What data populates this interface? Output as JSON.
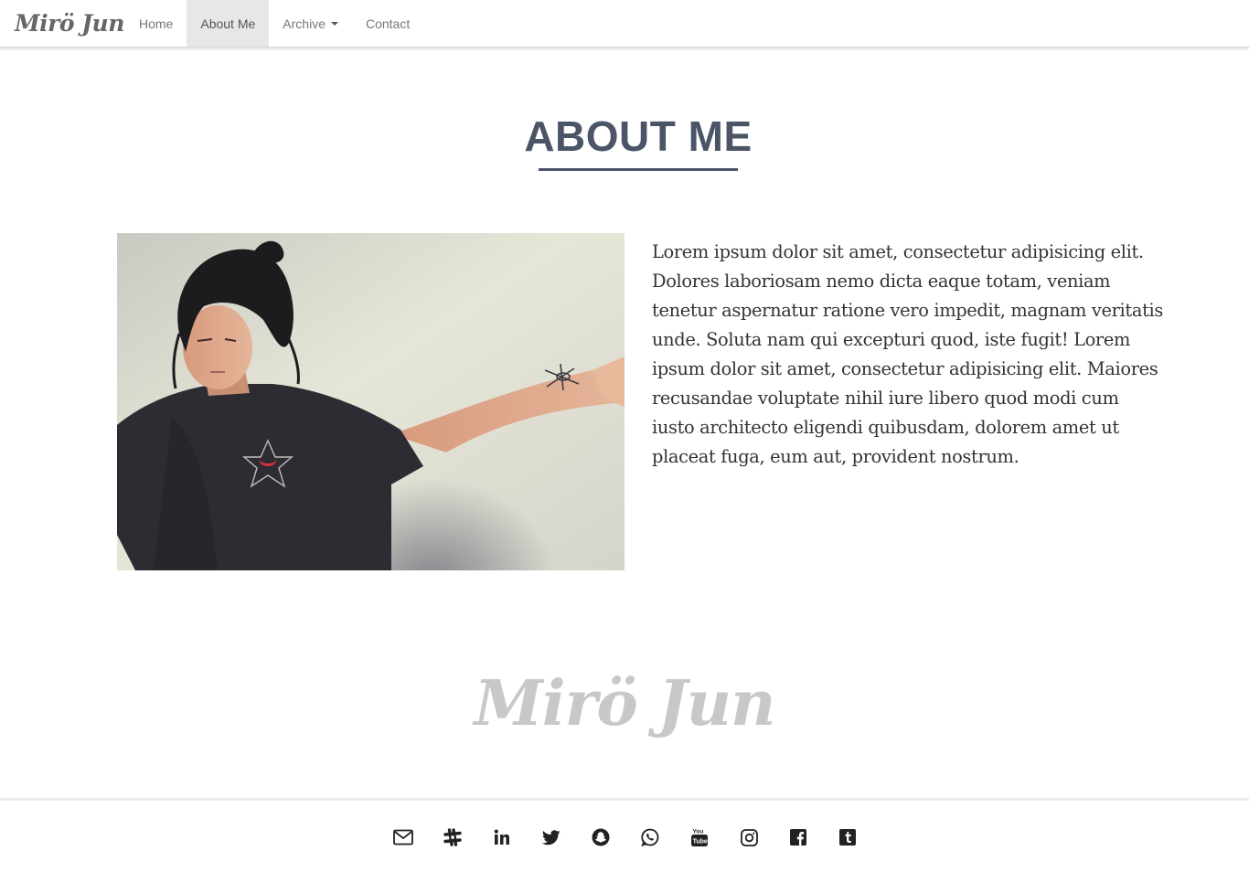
{
  "brand": {
    "name": "Mirö Jun"
  },
  "nav": {
    "items": [
      {
        "label": "Home"
      },
      {
        "label": "About Me",
        "active": true
      },
      {
        "label": "Archive"
      },
      {
        "label": "Contact"
      }
    ]
  },
  "main": {
    "title": "ABOUT ME",
    "bio": "Lorem ipsum dolor sit amet, consectetur adipisicing elit. Dolores laboriosam nemo dicta eaque totam, veniam tenetur aspernatur ratione vero impedit, magnam veritatis unde. Soluta nam qui excepturi quod, iste fugit! Lorem ipsum dolor sit amet, consectetur adipisicing elit. Maiores recusandae voluptate nihil iure libero quod modi cum iusto architecto eligendi quibusdam, dolorem amet ut placeat fuga, eum aut, provident nostrum."
  },
  "footer": {
    "logo": "Mirö Jun",
    "social_icons": [
      "envelope-icon",
      "slack-icon",
      "linkedin-icon",
      "twitter-icon",
      "snapchat-icon",
      "whatsapp-icon",
      "youtube-icon",
      "instagram-icon",
      "facebook-icon",
      "tumblr-icon"
    ]
  },
  "colors": {
    "title": "#4b5567",
    "nav_active_bg": "#e7e7e7",
    "footer_logo": "#c8c8c8"
  }
}
